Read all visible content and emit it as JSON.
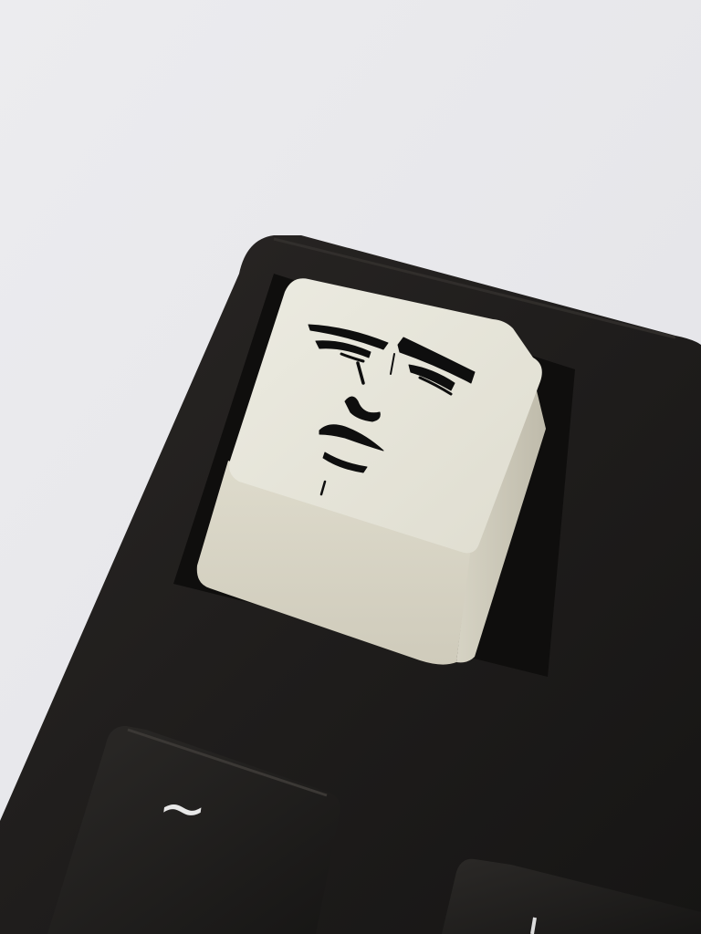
{
  "scene": {
    "description_kind": "photo",
    "subject": "keyboard-corner-with-face-keycap"
  },
  "keys": {
    "escape": {
      "legend_type": "illustrated-face",
      "color": "#e4e1d3"
    },
    "tilde": {
      "label": "~",
      "color": "#1d1b1a"
    },
    "number_one_partial": {
      "label": "",
      "color": "#1d1b1a"
    }
  },
  "colors": {
    "background": "#e9e9ec",
    "keyboard_case": "#1e1c1b",
    "keycap_white": "#e4e1d3",
    "keycap_black": "#1d1b1a",
    "face_ink": "#0e0e0e"
  }
}
